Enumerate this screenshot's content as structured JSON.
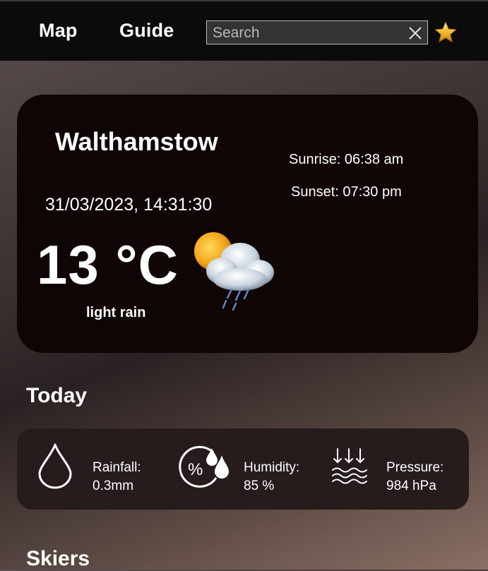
{
  "nav": {
    "map_label": "Map",
    "guide_label": "Guide",
    "search_placeholder": "Search"
  },
  "weather": {
    "city": "Walthamstow",
    "datetime": "31/03/2023, 14:31:30",
    "temperature": "13 °C",
    "description": "light rain",
    "sunrise": "Sunrise: 06:38 am",
    "sunset": "Sunset: 07:30 pm",
    "icon": "sun-cloud-rain-icon"
  },
  "today": {
    "title": "Today",
    "rainfall_label": "Rainfall:",
    "rainfall_value": "0.3mm",
    "humidity_label": "Humidity:",
    "humidity_value": "85 %",
    "pressure_label": "Pressure:",
    "pressure_value": "984 hPa"
  },
  "skiers": {
    "title": "Skiers"
  }
}
